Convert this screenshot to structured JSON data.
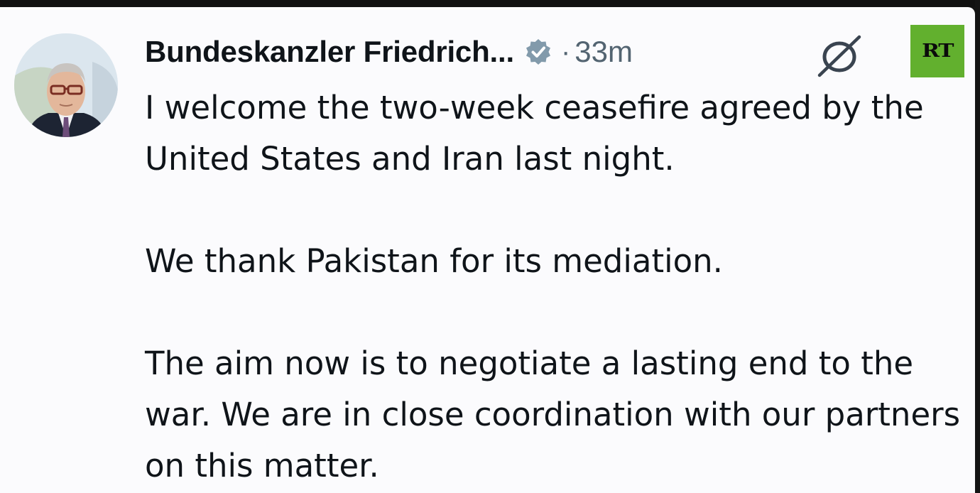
{
  "tweet": {
    "author_name": "Bundeskanzler Friedrich...",
    "separator": "·",
    "time": "33m",
    "paragraphs": [
      "I welcome the two-week ceasefire agreed by the United States and Iran last night.",
      "We thank Pakistan for its mediation.",
      "The aim now is to negotiate a lasting end to the war. We are in close coordination with our partners on this matter."
    ]
  },
  "icons": {
    "verified": "verified-badge-icon",
    "grok": "grok-icon"
  },
  "watermark": {
    "label": "RT",
    "color": "#62b02e"
  },
  "colors": {
    "background": "#fbfbfd",
    "text": "#0f1419",
    "secondary_text": "#536471",
    "verified_badge": "#829aab"
  }
}
